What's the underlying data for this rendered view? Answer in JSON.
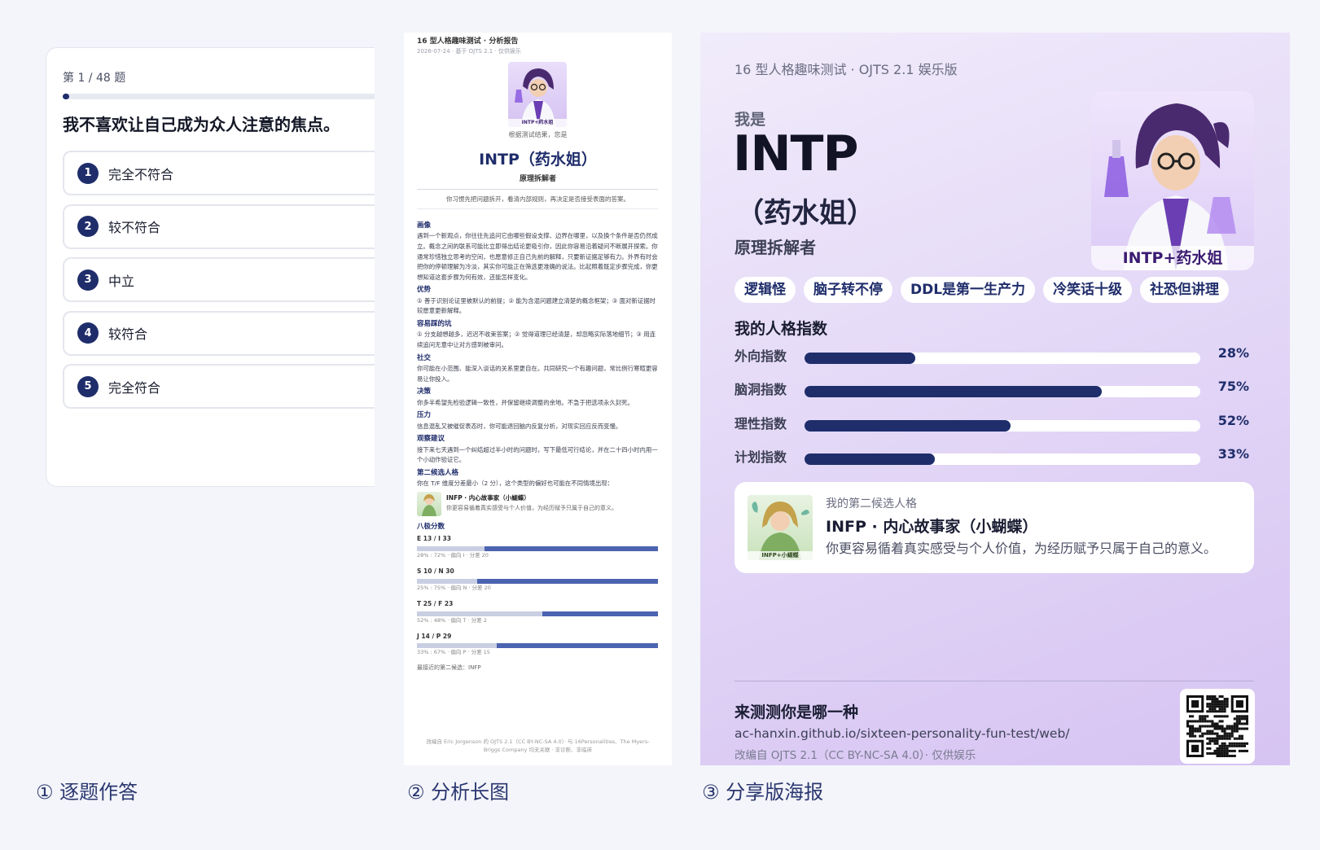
{
  "quiz": {
    "counter": "第 1 / 48 题",
    "progress": 0.0208,
    "question": "我不喜欢让自己成为众人注意的焦点。",
    "options": [
      {
        "num": "1",
        "label": "完全不符合"
      },
      {
        "num": "2",
        "label": "较不符合"
      },
      {
        "num": "3",
        "label": "中立"
      },
      {
        "num": "4",
        "label": "较符合"
      },
      {
        "num": "5",
        "label": "完全符合"
      }
    ]
  },
  "captions": {
    "c1": "① 逐题作答",
    "c2": "② 分析长图",
    "c3": "③ 分享版海报"
  },
  "report": {
    "header": "16 型人格趣味测试 · 分析报告",
    "meta": "2026-07-24 · 基于 OJTS 2.1 · 仅供娱乐",
    "avatar_label": "INTP+药水姐",
    "result_caption": "根据测试结果，您是",
    "type_name": "INTP（药水姐）",
    "subtitle": "原理拆解者",
    "quote": "你习惯先把问题拆开，看清内部规则，再决定是否接受表面的答案。",
    "sections": [
      {
        "h": "画像",
        "p": "遇到一个新观点，你往往先追问它由哪些假设支撑、边界在哪里，以及换个条件是否仍然成立。概念之间的联系可能比立即得出结论更吸引你，因此你容易沿着疑问不断展开探索。你通常珍惜独立思考的空间，也愿意修正自己先前的解释，只要新证据足够有力。外界有时会把你的停顿理解为冷淡，其实你可能正在筛选更准确的说法。比起照着既定步骤完成，你更想知道这套步骤为何有效，还能怎样变化。"
      },
      {
        "h": "优势",
        "p": "① 善于识别论证里被默认的前提；② 能为含混问题建立清楚的概念框架；③ 面对新证据时较愿意更新解释。"
      },
      {
        "h": "容易踩的坑",
        "p": "① 分支越想越多，迟迟不收束答案；② 觉得道理已经清楚，却忽略实际落地细节；③ 用连续追问无意中让对方感到被审问。"
      },
      {
        "h": "社交",
        "p": "你可能在小范围、能深入谈话的关系里更自在。共同研究一个有趣问题，常比例行寒暄更容易让你投入。"
      },
      {
        "h": "决策",
        "p": "你多半希望先检验逻辑一致性，并保留继续调整的余地。不急于把选项永久封死。"
      },
      {
        "h": "压力",
        "p": "信息混乱又被催促表态时，你可能退回脑内反复分析，对现实回应反而变慢。"
      },
      {
        "h": "观察建议",
        "p": "接下来七天遇到一个纠结超过半小时的问题时，写下最低可行结论，并在二十四小时内用一个小动作验证它。"
      }
    ],
    "alt": {
      "h": "第二候选人格",
      "intro": "你在 T/F 维度分差最小（2 分），这个类型的偏好也可能在不同情境出现：",
      "title": "INFP · 内心故事家（小蝴蝶）",
      "desc": "你更容易循着真实感受与个人价值，为经历赋予只属于自己的意义。",
      "img_label": "INFP+小蝴蝶"
    },
    "axes_h": "八极分数",
    "axes": [
      {
        "label": "E 13 / I 33",
        "right": 0.72,
        "note": "28% : 72% · 偏向 I · 分差 20"
      },
      {
        "label": "S 10 / N 30",
        "right": 0.75,
        "note": "25% : 75% · 偏向 N · 分差 20"
      },
      {
        "label": "T 25 / F 23",
        "right": 0.48,
        "note": "52% : 48% · 偏向 T · 分差 2"
      },
      {
        "label": "J 14 / P 29",
        "right": 0.67,
        "note": "33% : 67% · 偏向 P · 分差 15"
      }
    ],
    "nearest": "最接近的第二候选：INFP",
    "footer": "改编自 Eric Jorgenson 的 OJTS 2.1（CC BY-NC-SA 4.0）· 与 16Personalities、The Myers-Briggs Company 均无关联 · 非诊断、非临床"
  },
  "poster": {
    "header": "16 型人格趣味测试 · OJTS 2.1 娱乐版",
    "iam": "我是",
    "type": "INTP",
    "nick": "（药水姐）",
    "subtitle": "原理拆解者",
    "avatar_label": "INTP+药水姐",
    "tags": [
      "逻辑怪",
      "脑子转不停",
      "DDL是第一生产力",
      "冷笑话十级",
      "社恐但讲理"
    ],
    "index_title": "我的人格指数",
    "indexes": [
      {
        "label": "外向指数",
        "value": 28,
        "text": "28%"
      },
      {
        "label": "脑洞指数",
        "value": 75,
        "text": "75%"
      },
      {
        "label": "理性指数",
        "value": 52,
        "text": "52%"
      },
      {
        "label": "计划指数",
        "value": 33,
        "text": "33%"
      }
    ],
    "alt": {
      "kicker": "我的第二候选人格",
      "title": "INFP · 内心故事家（小蝴蝶）",
      "desc": "你更容易循着真实感受与个人价值，为经历赋予只属于自己的意义。",
      "img_label": "INFP+小蝴蝶"
    },
    "cta": "来测测你是哪一种",
    "url": "ac-hanxin.github.io/sixteen-personality-fun-test/web/",
    "license": "改编自 OJTS 2.1（CC BY-NC-SA 4.0）· 仅供娱乐"
  },
  "colors": {
    "accent": "#1f2d6b",
    "bar": "#4b63b0",
    "poster_bg": "#e4d9f7"
  }
}
